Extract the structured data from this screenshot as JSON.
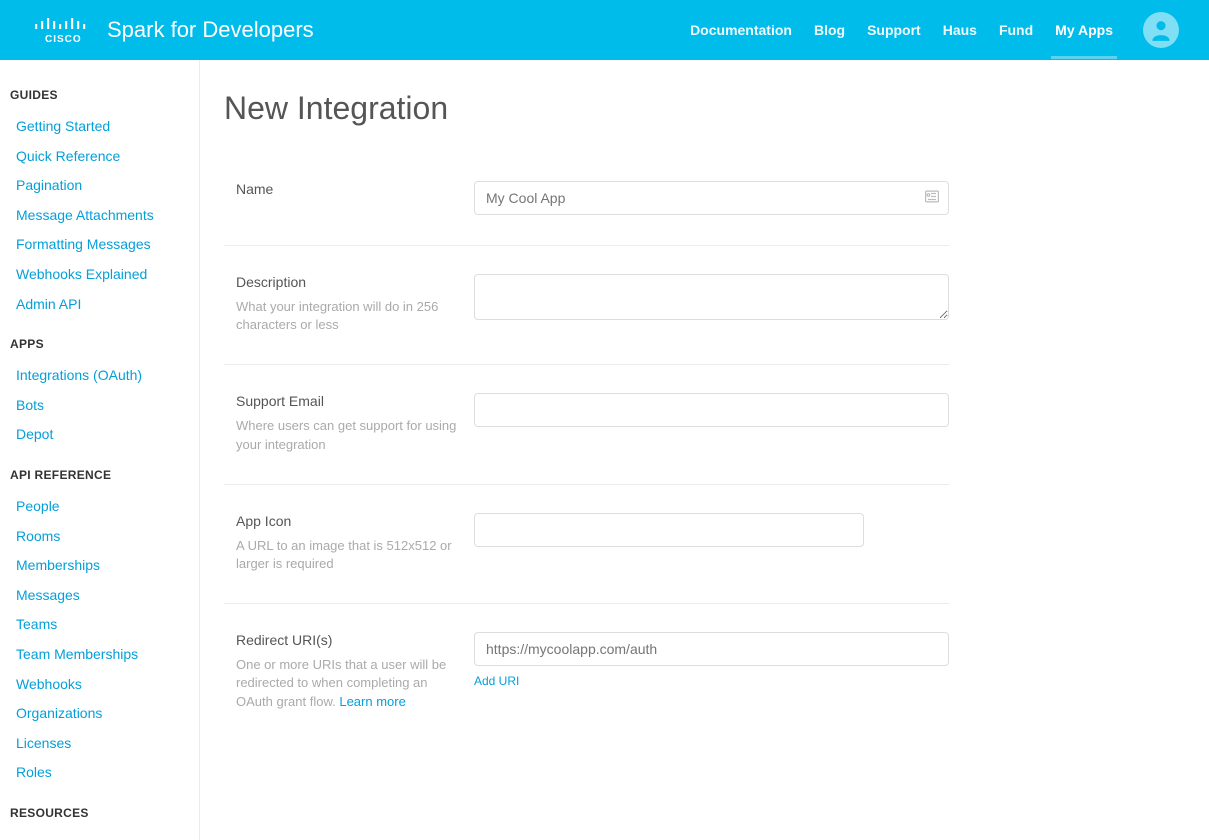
{
  "header": {
    "site_title": "Spark for Developers",
    "nav": [
      {
        "label": "Documentation",
        "active": false
      },
      {
        "label": "Blog",
        "active": false
      },
      {
        "label": "Support",
        "active": false
      },
      {
        "label": "Haus",
        "active": false
      },
      {
        "label": "Fund",
        "active": false
      },
      {
        "label": "My Apps",
        "active": true
      }
    ]
  },
  "sidebar": {
    "sections": [
      {
        "heading": "GUIDES",
        "items": [
          "Getting Started",
          "Quick Reference",
          "Pagination",
          "Message Attachments",
          "Formatting Messages",
          "Webhooks Explained",
          "Admin API"
        ]
      },
      {
        "heading": "APPS",
        "items": [
          "Integrations (OAuth)",
          "Bots",
          "Depot"
        ]
      },
      {
        "heading": "API REFERENCE",
        "items": [
          "People",
          "Rooms",
          "Memberships",
          "Messages",
          "Teams",
          "Team Memberships",
          "Webhooks",
          "Organizations",
          "Licenses",
          "Roles"
        ]
      },
      {
        "heading": "RESOURCES",
        "items": []
      }
    ]
  },
  "page": {
    "title": "New Integration",
    "fields": {
      "name": {
        "label": "Name",
        "placeholder": "My Cool App"
      },
      "description": {
        "label": "Description",
        "hint": "What your integration will do in 256 characters or less"
      },
      "support_email": {
        "label": "Support Email",
        "hint": "Where users can get support for using your integration"
      },
      "app_icon": {
        "label": "App Icon",
        "hint": "A URL to an image that is 512x512 or larger is required"
      },
      "redirect_uris": {
        "label": "Redirect URI(s)",
        "hint_prefix": "One or more URIs that a user will be redirected to when completing an OAuth grant flow. ",
        "hint_link": "Learn more",
        "placeholder": "https://mycoolapp.com/auth",
        "add_label": "Add URI"
      }
    }
  }
}
